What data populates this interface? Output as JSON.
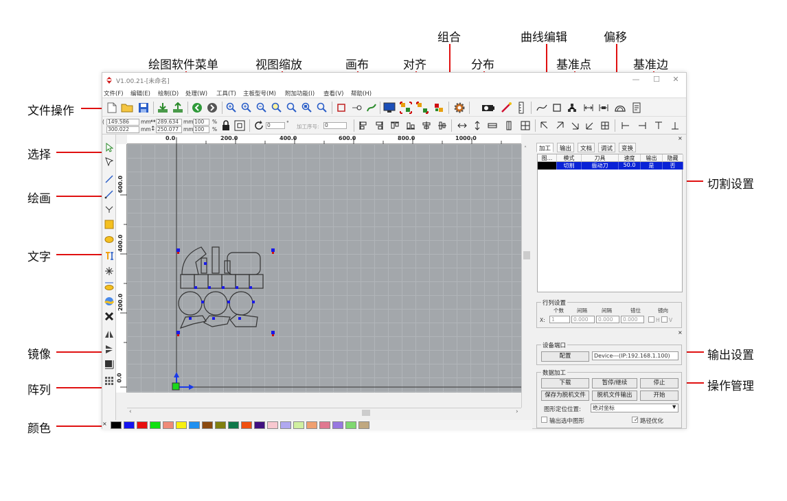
{
  "callouts": {
    "file_ops": "文件操作",
    "drawing_menu": "绘图软件菜单",
    "view_zoom": "视图缩放",
    "canvas": "画布",
    "align": "对齐",
    "group": "组合",
    "distribute": "分布",
    "curve_edit": "曲线编辑",
    "ref_point": "基准点",
    "offset": "偏移",
    "ref_edge": "基准边",
    "select": "选择",
    "draw": "绘画",
    "text": "文字",
    "mirror": "镜像",
    "array": "阵列",
    "color": "颜色",
    "cut_settings": "切割设置",
    "output_settings": "输出设置",
    "operation_mgmt": "操作管理"
  },
  "window": {
    "title": "V1.00.21-[未命名]",
    "minimize": "—",
    "maximize": "☐",
    "close": "✕"
  },
  "menu": [
    "文件(F)",
    "编辑(E)",
    "绘制(D)",
    "处理(W)",
    "工具(T)",
    "主板型号(M)",
    "附加功能(I)",
    "查看(V)",
    "帮助(H)"
  ],
  "props": {
    "x": "149.586",
    "y": "300.022",
    "w": "289.634",
    "h": "250.077",
    "unit": "mm",
    "scale_x": "100",
    "scale_y": "100",
    "percent": "%",
    "angle": "0",
    "degree": "°",
    "seq_label": "加工序号:",
    "seq_value": "0"
  },
  "ruler": {
    "top": [
      "0.0",
      "200.0",
      "400.0",
      "600.0",
      "800.0",
      "1000.0"
    ],
    "left": [
      "600.0",
      "400.0",
      "200.0",
      "0.0"
    ]
  },
  "colors": [
    "#000000",
    "#1414f0",
    "#e81010",
    "#10e010",
    "#f08a78",
    "#f8f010",
    "#2090f0",
    "#8c4a10",
    "#808010",
    "#10784a",
    "#f05010",
    "#401080",
    "#f8c8d0",
    "#b0a8f0",
    "#d0f0a0",
    "#f0a070",
    "#e07890",
    "#9878e0",
    "#80d870",
    "#c0a880"
  ],
  "panel": {
    "tabs": [
      "加工",
      "输出",
      "文档",
      "调试",
      "变换"
    ],
    "layer_headers": [
      "图...",
      "模式",
      "刀具",
      "速度",
      "输出",
      "隐藏"
    ],
    "layer_row": [
      "",
      "切割",
      "振动刀",
      "50.0",
      "是",
      "否"
    ],
    "array": {
      "title": "行列设置",
      "headers": [
        "个数",
        "间隔",
        "间隔",
        "错位",
        "镜向"
      ],
      "x_label": "X:",
      "count": "1",
      "gap1": "0.000",
      "gap2": "0.000",
      "offset": "0.000",
      "mirror_h": "H",
      "mirror_v": "V"
    },
    "device": {
      "title": "设备端口",
      "config": "配置",
      "port": "Device---(IP:192.168.1.100)"
    },
    "data": {
      "title": "数据加工",
      "download": "下载",
      "pause": "暂停/继续",
      "stop": "停止",
      "save_offline": "保存为脱机文件",
      "offline_out": "脱机文件输出",
      "start": "开始",
      "pos_label": "图形定位位置:",
      "pos_value": "绝对坐标",
      "cb1": "输出选中图形",
      "cb2": "路径优化"
    }
  }
}
